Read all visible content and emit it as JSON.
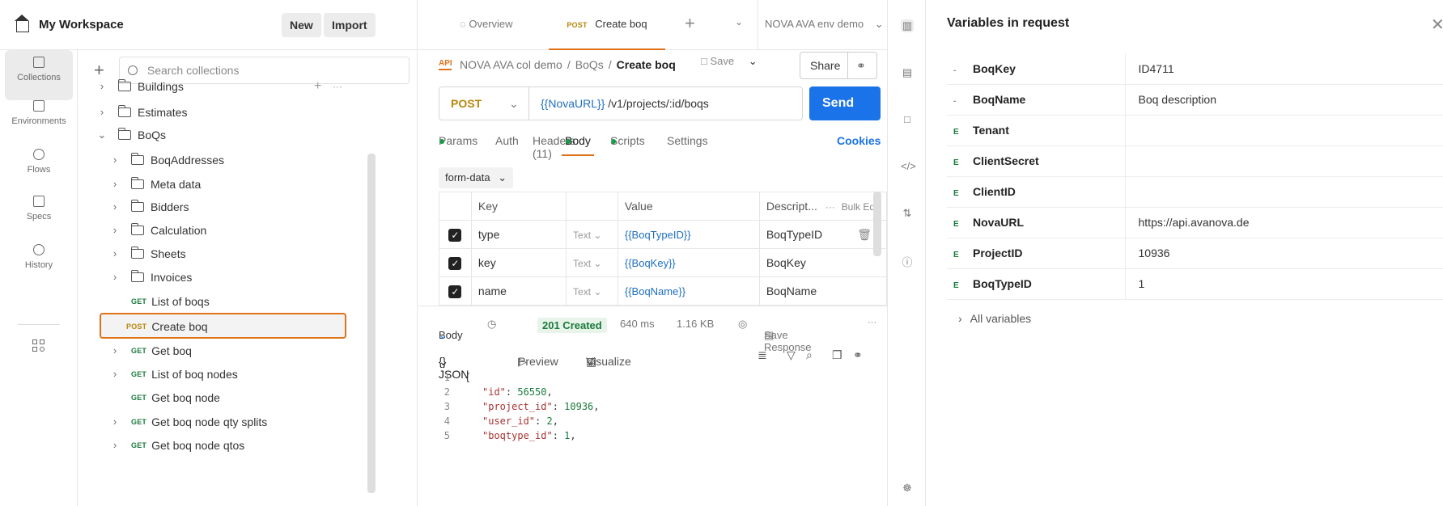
{
  "workspace": {
    "title": "My Workspace",
    "new_label": "New",
    "import_label": "Import"
  },
  "rail": [
    {
      "label": "Collections",
      "icon": "collections-icon"
    },
    {
      "label": "Environments",
      "icon": "environments-icon"
    },
    {
      "label": "Flows",
      "icon": "flows-icon"
    },
    {
      "label": "Specs",
      "icon": "specs-icon"
    },
    {
      "label": "History",
      "icon": "history-icon"
    }
  ],
  "search": {
    "placeholder": "Search collections"
  },
  "tree": {
    "buildings": "Buildings",
    "estimates": "Estimates",
    "boqs": "BoQs",
    "folders": [
      "BoqAddresses",
      "Meta data",
      "Bidders",
      "Calculation",
      "Sheets",
      "Invoices"
    ],
    "requests": [
      {
        "method": "GET",
        "name": "List of boqs"
      },
      {
        "method": "POST",
        "name": "Create boq"
      },
      {
        "method": "GET",
        "name": "Get boq"
      },
      {
        "method": "GET",
        "name": "List of boq nodes"
      },
      {
        "method": "GET",
        "name": "Get boq node"
      },
      {
        "method": "GET",
        "name": "Get boq node qty splits"
      },
      {
        "method": "GET",
        "name": "Get boq node qtos"
      }
    ]
  },
  "tabs": {
    "overview": "Overview",
    "active_method": "POST",
    "active_name": "Create boq",
    "env": "NOVA AVA env demo"
  },
  "breadcrumb": {
    "collection": "NOVA AVA col demo",
    "folder": "BoQs",
    "current": "Create boq",
    "sep": "/"
  },
  "actions": {
    "save": "Save",
    "share": "Share",
    "send": "Send"
  },
  "request": {
    "method": "POST",
    "url_var": "{{NovaURL}}",
    "url_path": " /v1/projects/:id/boqs"
  },
  "req_tabs": {
    "params": "Params",
    "auth": "Auth",
    "headers": "Headers (11)",
    "body": "Body",
    "scripts": "Scripts",
    "settings": "Settings",
    "cookies": "Cookies"
  },
  "body_mode": "form-data",
  "kv_header": {
    "key": "Key",
    "value": "Value",
    "desc": "Descript...",
    "more": "···",
    "bulk": "Bulk Edit"
  },
  "kv_rows": [
    {
      "key": "type",
      "type": "Text",
      "value": "{{BoqTypeID}}",
      "desc": "BoqTypeID"
    },
    {
      "key": "key",
      "type": "Text",
      "value": "{{BoqKey}}",
      "desc": "BoqKey"
    },
    {
      "key": "name",
      "type": "Text",
      "value": "{{BoqName}}",
      "desc": "BoqName"
    }
  ],
  "response": {
    "label": "Body",
    "status": "201 Created",
    "time": "640 ms",
    "size": "1.16 KB",
    "save": "Save Response",
    "format": "{} JSON",
    "preview": "Preview",
    "visualize": "Visualize"
  },
  "json_lines": [
    {
      "n": "1",
      "text": "{"
    },
    {
      "n": "2",
      "key": "\"id\"",
      "val": "56550"
    },
    {
      "n": "3",
      "key": "\"project_id\"",
      "val": "10936"
    },
    {
      "n": "4",
      "key": "\"user_id\"",
      "val": "2"
    },
    {
      "n": "5",
      "key": "\"boqtype_id\"",
      "val": "1"
    }
  ],
  "vars_panel": {
    "title": "Variables in request",
    "rows": [
      {
        "badge": "-",
        "name": "BoqKey",
        "value": "ID4711"
      },
      {
        "badge": "-",
        "name": "BoqName",
        "value": "Boq description"
      },
      {
        "badge": "E",
        "name": "Tenant",
        "value": ""
      },
      {
        "badge": "E",
        "name": "ClientSecret",
        "value": ""
      },
      {
        "badge": "E",
        "name": "ClientID",
        "value": ""
      },
      {
        "badge": "E",
        "name": "NovaURL",
        "value": "https://api.avanova.de"
      },
      {
        "badge": "E",
        "name": "ProjectID",
        "value": "10936"
      },
      {
        "badge": "E",
        "name": "BoqTypeID",
        "value": "1"
      }
    ],
    "all_vars": "All variables"
  },
  "colors": {
    "accent": "#e0731a",
    "send": "#1a73e8",
    "get": "#1a7a3c",
    "post": "#b8860b"
  }
}
